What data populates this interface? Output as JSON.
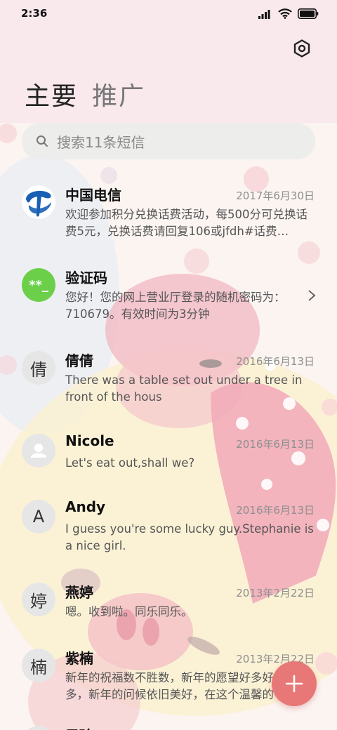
{
  "status_bar": {
    "time": "2:36"
  },
  "tabs": [
    {
      "label": "主要",
      "active": true
    },
    {
      "label": "推广",
      "active": false
    }
  ],
  "search": {
    "placeholder": "搜索11条短信"
  },
  "threads": [
    {
      "name": "中国电信",
      "date": "2017年6月30日",
      "preview": "欢迎参加积分兑换话费活动，每500分可兑换话费5元，兑换话费请回复106或jfdh#话费…",
      "avatar": {
        "type": "logo",
        "icon": "china-telecom-logo"
      }
    },
    {
      "name": "验证码",
      "date": "",
      "preview": "您好！您的网上营业厅登录的随机密码为：710679。有效时间为3分钟",
      "avatar": {
        "type": "badge",
        "text": "**_",
        "color": "#6ccf4a"
      }
    },
    {
      "name": "倩倩",
      "date": "2016年6月13日",
      "preview": "There was a table set out under a tree in front of the hous",
      "avatar": {
        "type": "letter",
        "text": "倩"
      }
    },
    {
      "name": "Nicole",
      "date": "2016年6月13日",
      "preview": "Let's eat out,shall we?",
      "avatar": {
        "type": "icon",
        "icon": "person-icon"
      }
    },
    {
      "name": "Andy",
      "date": "2016年6月13日",
      "preview": "I guess you're some lucky guy.Stephanie is a nice girl.",
      "avatar": {
        "type": "letter",
        "text": "A"
      }
    },
    {
      "name": "燕婷",
      "date": "2013年2月22日",
      "preview": "嗯。收到啦。同乐同乐。",
      "avatar": {
        "type": "letter",
        "text": "婷"
      }
    },
    {
      "name": "紫楠",
      "date": "2013年2月22日",
      "preview": "新年的祝福数不胜数，新年的愿望好多好多，新年的问候依旧美好，在这个温馨的时刻…",
      "avatar": {
        "type": "letter",
        "text": "楠"
      }
    },
    {
      "name": "子玲",
      "date": "",
      "preview": "",
      "avatar": {
        "type": "letter",
        "text": ""
      }
    }
  ],
  "colors": {
    "accent": "#e87878",
    "verify_green": "#6ccf4a",
    "telecom_blue": "#1a5fb4"
  }
}
